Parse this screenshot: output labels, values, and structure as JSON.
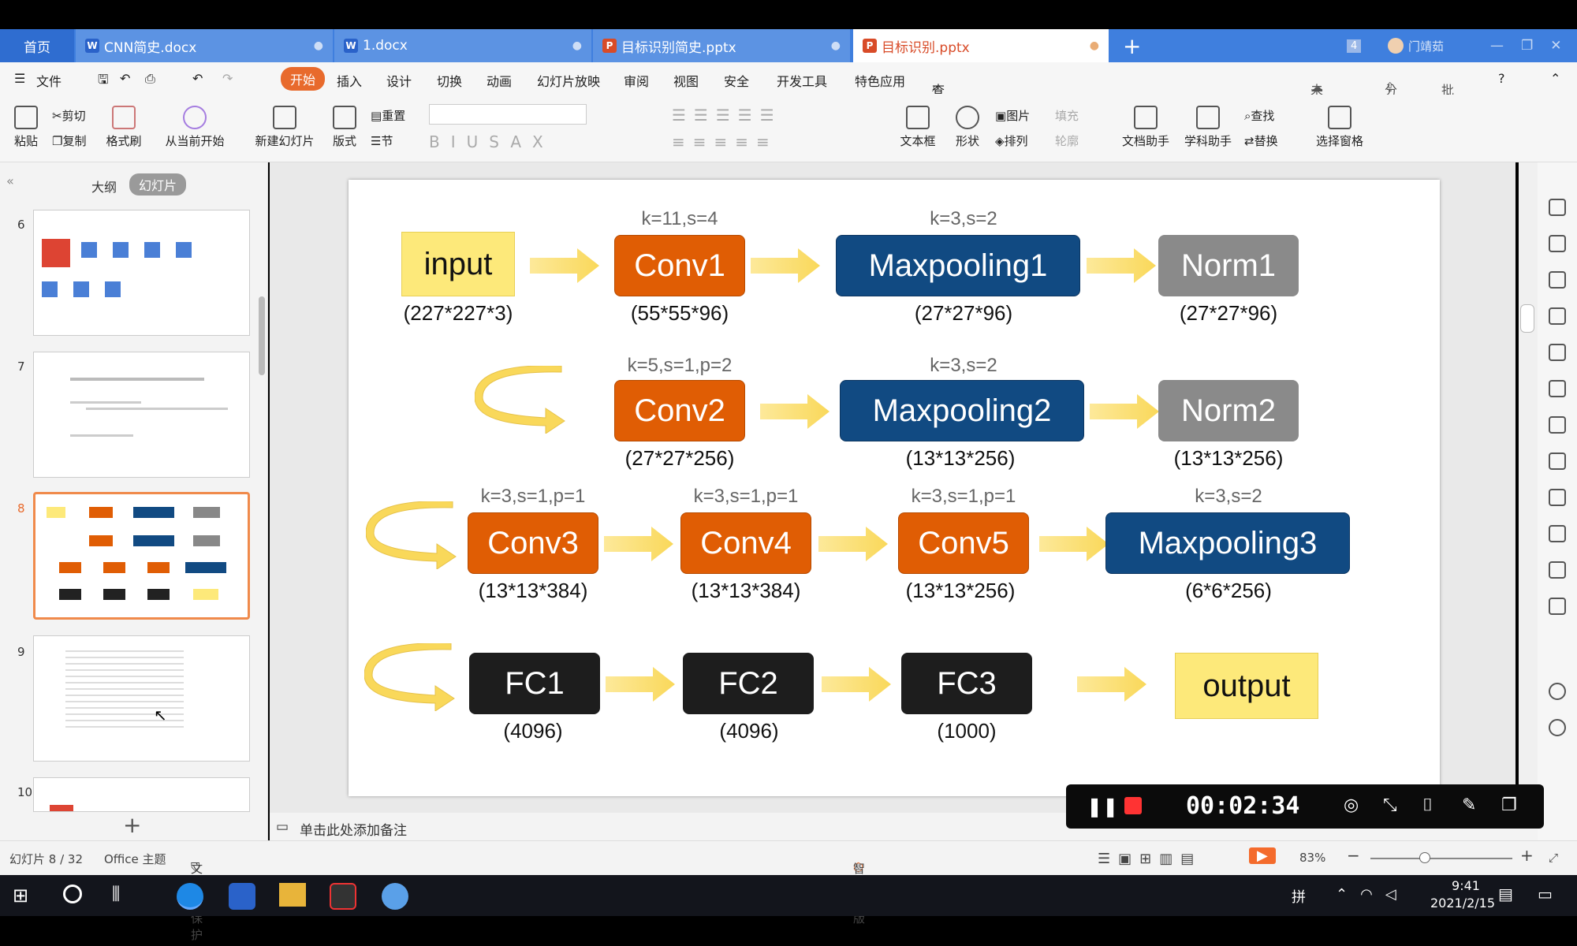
{
  "tabs": [
    {
      "label": "首页"
    },
    {
      "label": "CNN简史.docx"
    },
    {
      "label": "1.docx"
    },
    {
      "label": "目标识别简史.pptx"
    },
    {
      "label": "目标识别.pptx"
    }
  ],
  "tab_count": "4",
  "user": "门靖茹",
  "menu": {
    "file": "文件",
    "start": "开始",
    "insert": "插入",
    "design": "设计",
    "switch": "切换",
    "animation": "动画",
    "slideshow": "幻灯片放映",
    "review": "审阅",
    "view": "视图",
    "security": "安全",
    "devtools": "开发工具",
    "special": "特色应用",
    "find": "查找",
    "sync": "未同步",
    "share": "分享",
    "annotate": "批注"
  },
  "ribbon": {
    "paste": "粘贴",
    "cut": "剪切",
    "copy": "复制",
    "format_painter": "格式刷",
    "from_current": "从当前开始",
    "new_slide": "新建幻灯片",
    "layout": "版式",
    "reset": "重置",
    "section": "节",
    "textbox": "文本框",
    "shape": "形状",
    "picture": "图片",
    "arrange": "排列",
    "fill": "填充",
    "outline": "轮廓",
    "doc_helper": "文档助手",
    "subject_helper": "学科助手",
    "find": "查找",
    "replace": "替换",
    "select_pane": "选择窗格"
  },
  "panel": {
    "outline_tab": "大纲",
    "slides_tab": "幻灯片",
    "slide_numbers": [
      "6",
      "7",
      "8",
      "9",
      "10"
    ]
  },
  "slide": {
    "row1": {
      "input": {
        "label": "input",
        "dim": "(227*227*3)"
      },
      "conv1": {
        "label": "Conv1",
        "param": "k=11,s=4",
        "dim": "(55*55*96)"
      },
      "maxpool1": {
        "label": "Maxpooling1",
        "param": "k=3,s=2",
        "dim": "(27*27*96)"
      },
      "norm1": {
        "label": "Norm1",
        "dim": "(27*27*96)"
      }
    },
    "row2": {
      "conv2": {
        "label": "Conv2",
        "param": "k=5,s=1,p=2",
        "dim": "(27*27*256)"
      },
      "maxpool2": {
        "label": "Maxpooling2",
        "param": "k=3,s=2",
        "dim": "(13*13*256)"
      },
      "norm2": {
        "label": "Norm2",
        "dim": "(13*13*256)"
      }
    },
    "row3": {
      "conv3": {
        "label": "Conv3",
        "param": "k=3,s=1,p=1",
        "dim": "(13*13*384)"
      },
      "conv4": {
        "label": "Conv4",
        "param": "k=3,s=1,p=1",
        "dim": "(13*13*384)"
      },
      "conv5": {
        "label": "Conv5",
        "param": "k=3,s=1,p=1",
        "dim": "(13*13*256)"
      },
      "maxpool3": {
        "label": "Maxpooling3",
        "param": "k=3,s=2",
        "dim": "(6*6*256)"
      }
    },
    "row4": {
      "fc1": {
        "label": "FC1",
        "dim": "(4096)"
      },
      "fc2": {
        "label": "FC2",
        "dim": "(4096)"
      },
      "fc3": {
        "label": "FC3",
        "dim": "(1000)"
      },
      "output": {
        "label": "output"
      }
    }
  },
  "notes": "单击此处添加备注",
  "status": {
    "slide": "幻灯片 8 / 32",
    "theme": "Office 主题",
    "protect": "文档未保护",
    "smart": "智能排版",
    "zoom": "83%"
  },
  "recorder": {
    "time": "00:02:34"
  },
  "taskbar": {
    "ime": "拼",
    "time": "9:41",
    "date": "2021/2/15"
  },
  "colors": {
    "orange": "#e05d04",
    "blue": "#114a82",
    "gray": "#8a8a8a",
    "black": "#1d1d1d",
    "yellow": "#fde97a",
    "tabbar": "#3f7fde"
  }
}
